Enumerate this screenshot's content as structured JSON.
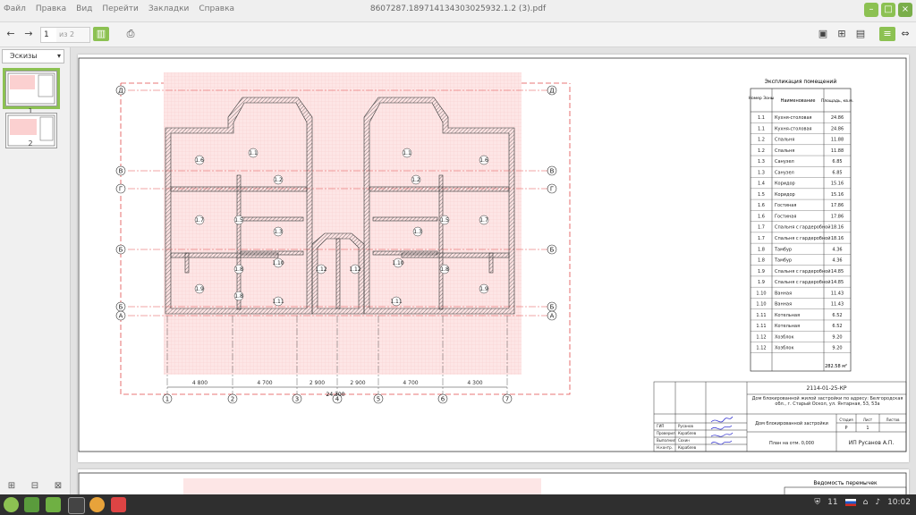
{
  "window": {
    "title": "8607287.189714134303025932.1.2 (3).pdf",
    "menu": [
      "Файл",
      "Правка",
      "Вид",
      "Перейти",
      "Закладки",
      "Справка"
    ]
  },
  "toolbar": {
    "page_current": "1",
    "page_of": "из 2",
    "back_icon": "arrow-left-icon",
    "forward_icon": "arrow-right-icon"
  },
  "sidebar": {
    "tab_label": "Эскизы",
    "thumbs": [
      {
        "label": "1"
      },
      {
        "label": "2"
      }
    ]
  },
  "drawing": {
    "axis_letters": [
      "Д",
      "В",
      "Г",
      "Б",
      "Б",
      "А"
    ],
    "axis_numbers": [
      "1",
      "2",
      "3",
      "4",
      "5",
      "6",
      "7"
    ],
    "dims": [
      "4 800",
      "4 700",
      "2 900",
      "2 900",
      "4 700",
      "4 300"
    ],
    "total_dim": "24 300",
    "rooms_left": [
      "1.1",
      "1.6",
      "1.2",
      "1.7",
      "1.5",
      "1.3",
      "1.8",
      "1.10",
      "1.9",
      "1.8",
      "1.11",
      "1.12"
    ],
    "rooms_right": [
      "1.1",
      "1.6",
      "1.2",
      "1.7",
      "1.5",
      "1.3",
      "1.10",
      "1.8",
      "1.9",
      "1.11",
      "1.12"
    ]
  },
  "explication": {
    "title": "Экспликация помещений",
    "headers": [
      "Номер Зоны",
      "Наименование",
      "Площадь, кв.м."
    ],
    "rows": [
      [
        "1.1",
        "Кухня-столовая",
        "24.86"
      ],
      [
        "1.1",
        "Кухня-столовая",
        "24.86"
      ],
      [
        "1.2",
        "Спальня",
        "11.88"
      ],
      [
        "1.2",
        "Спальня",
        "11.88"
      ],
      [
        "1.3",
        "Санузел",
        "6.85"
      ],
      [
        "1.3",
        "Санузел",
        "6.85"
      ],
      [
        "1.4",
        "Коридор",
        "15.16"
      ],
      [
        "1.5",
        "Коридор",
        "15.16"
      ],
      [
        "1.6",
        "Гостиная",
        "17.86"
      ],
      [
        "1.6",
        "Гостиная",
        "17.86"
      ],
      [
        "1.7",
        "Спальня с гардеробной",
        "18.16"
      ],
      [
        "1.7",
        "Спальня с гардеробной",
        "18.16"
      ],
      [
        "1.8",
        "Тамбур",
        "4.36"
      ],
      [
        "1.8",
        "Тамбур",
        "4.36"
      ],
      [
        "1.9",
        "Спальня с гардеробной",
        "14.85"
      ],
      [
        "1.9",
        "Спальня с гардеробной",
        "14.85"
      ],
      [
        "1.10",
        "Ванная",
        "11.43"
      ],
      [
        "1.10",
        "Ванная",
        "11.43"
      ],
      [
        "1.11",
        "Котельная",
        "6.52"
      ],
      [
        "1.11",
        "Котельная",
        "6.52"
      ],
      [
        "1.12",
        "Хозблок",
        "9.20"
      ],
      [
        "1.12",
        "Хозблок",
        "9.20"
      ]
    ],
    "total": "282.58 м²"
  },
  "stamp": {
    "code": "2114-01-25-КР",
    "object": "Дом блокированной жилой застройки по адресу: Белгородская обл., г. Старый Оскол, ул. Янтарная, 53, 53а",
    "sheet_name": "Дом блокированной застройки",
    "plan_name": "План на отм. 0,000",
    "company": "ИП Русанов А.П.",
    "stage_headers": [
      "Стадия",
      "Лист",
      "Листов"
    ],
    "stage_values": [
      "Р",
      "1",
      ""
    ],
    "roles": [
      [
        "ГИП",
        "Русанов"
      ],
      [
        "Проверил",
        "Кораблев"
      ],
      [
        "Выполнил",
        "Сохин"
      ],
      [
        "Н.контр.",
        "Кораблев"
      ]
    ]
  },
  "page2": {
    "title": "Ведомость перемычек"
  },
  "taskbar": {
    "tray_count": "11",
    "clock": "10:02"
  },
  "colors": {
    "accent": "#8cc152",
    "drawing_fill": "#fde6e6",
    "drawing_grid": "#f6b8b8",
    "wall_hatch": "#555555"
  }
}
